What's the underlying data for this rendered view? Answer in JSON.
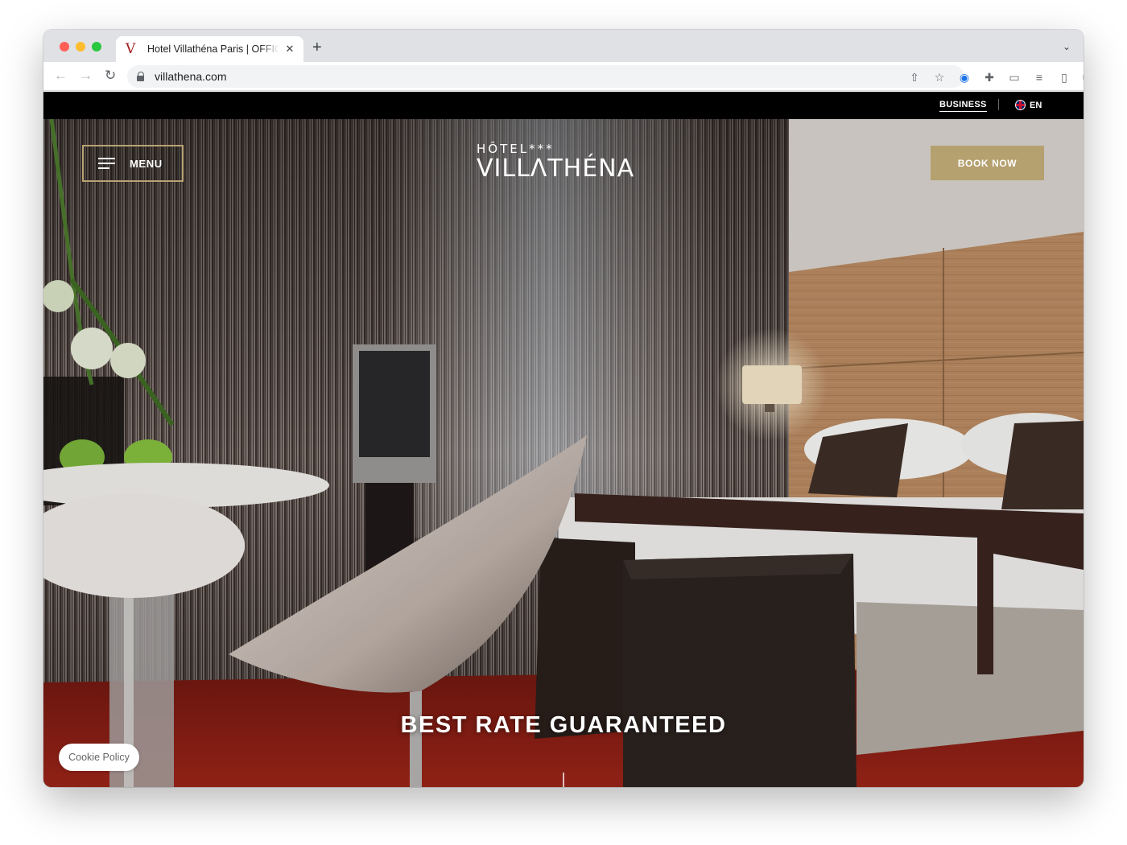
{
  "browser": {
    "tab_title": "Hotel Villathéna Paris | OFFICIAL",
    "tab_favicon": "V",
    "url": "villathena.com",
    "new_tab_glyph": "+",
    "close_glyph": "✕",
    "tab_menu_glyph": "⌄",
    "nav": {
      "back": "←",
      "forward": "→",
      "reload": "↻"
    },
    "toolbar_icons": [
      "share-icon",
      "bookmark-star-icon",
      "password-extension-icon",
      "puzzle-extensions-icon",
      "cast-icon",
      "reading-list-icon",
      "side-panel-icon",
      "profile-avatar",
      "more-menu-icon"
    ],
    "toolbar_glyphs": {
      "share": "⇧",
      "star": "☆",
      "ext1": "◉",
      "puzzle": "✚",
      "cast": "▭",
      "media": "≡",
      "sidepanel": "▯",
      "more": "⋮"
    }
  },
  "topbar": {
    "business_label": "BUSINESS",
    "language_label": "EN"
  },
  "hero": {
    "menu_label": "MENU",
    "logo_top": "HÔTEL***",
    "logo_main": "VILLΛTHÉNA",
    "book_label": "BOOK NOW",
    "headline": "BEST RATE GUARANTEED"
  },
  "cookie_label": "Cookie Policy",
  "colors": {
    "accent_gold": "#b5a06f",
    "topbar_black": "#000000",
    "carpet_red": "#8f1e14"
  }
}
